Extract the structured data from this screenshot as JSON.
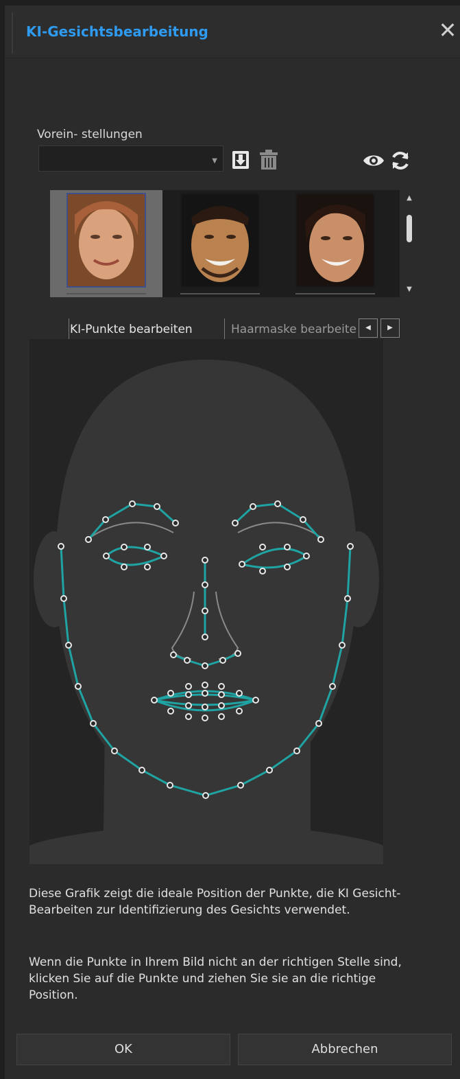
{
  "window": {
    "title": "KI-Gesichtsbearbeitung",
    "close_glyph": "✕"
  },
  "presets": {
    "label": "Vorein- stellungen",
    "selected_value": ""
  },
  "tabs": [
    {
      "label": "KI-Punkte bearbeiten",
      "active": true
    },
    {
      "label": "Haarmaske bearbeiten",
      "active": false
    }
  ],
  "description": {
    "paragraph1": "Diese Grafik zeigt die ideale Position der Punkte, die KI Gesicht-Bearbeiten zur Identifizierung des Gesichts verwendet.",
    "paragraph2": "Wenn die Punkte in Ihrem Bild nicht an der richtigen Stelle sind, klicken Sie auf die Punkte und ziehen Sie sie an die richtige Position."
  },
  "buttons": {
    "ok": "OK",
    "cancel": "Abbrechen"
  },
  "colors": {
    "accent": "#2f9bf0",
    "landmark_line": "#1fa3a3",
    "guide_line": "#8a8a8a",
    "head": "#363636"
  },
  "icons": [
    "close-icon",
    "chevron-down-icon",
    "save-preset-icon",
    "trash-icon",
    "eye-icon",
    "refresh-icon",
    "arrow-up-icon",
    "arrow-down-icon",
    "arrow-left-icon",
    "arrow-right-icon"
  ]
}
